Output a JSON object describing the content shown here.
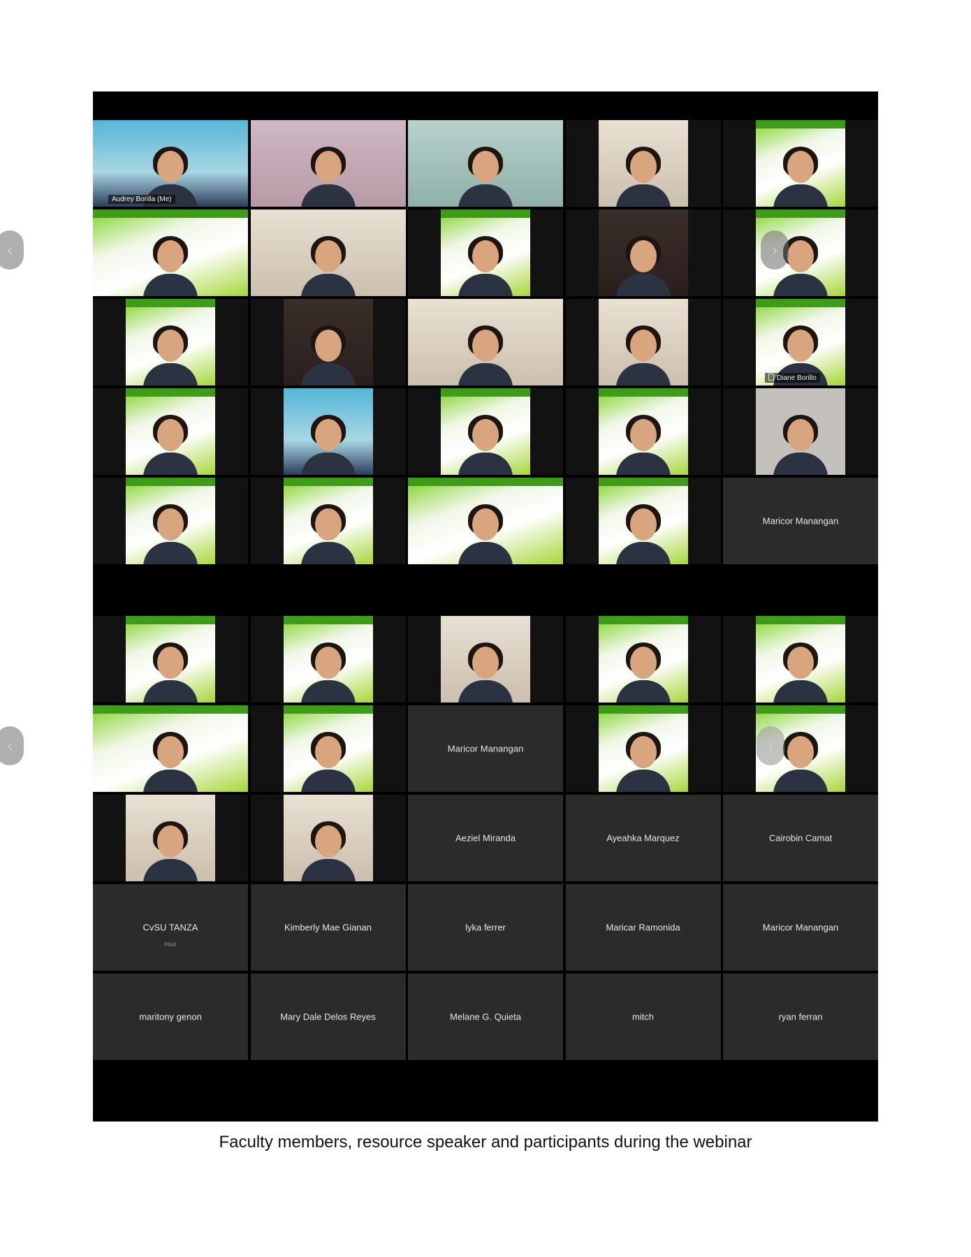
{
  "top_panel": {
    "tiles": [
      {
        "kind": "video",
        "style": "wall-blue full",
        "name": "Audrey Borilla  (Me)"
      },
      {
        "kind": "video",
        "style": "wall-pink full",
        "name": ""
      },
      {
        "kind": "video",
        "style": "wall-teal full",
        "name": ""
      },
      {
        "kind": "video",
        "style": "wall-cream center",
        "name": ""
      },
      {
        "kind": "video",
        "style": "slide center",
        "name": ""
      },
      {
        "kind": "video",
        "style": "slide full",
        "name": ""
      },
      {
        "kind": "video",
        "style": "wall-cream full",
        "name": ""
      },
      {
        "kind": "video",
        "style": "slide center",
        "name": ""
      },
      {
        "kind": "video",
        "style": "wall-dark center",
        "name": ""
      },
      {
        "kind": "video",
        "style": "slide center",
        "name": ""
      },
      {
        "kind": "video",
        "style": "slide center",
        "name": ""
      },
      {
        "kind": "video",
        "style": "wall-dark center",
        "name": ""
      },
      {
        "kind": "video",
        "style": "wall-cream full",
        "name": ""
      },
      {
        "kind": "video",
        "style": "wall-cream center",
        "name": ""
      },
      {
        "kind": "video",
        "style": "slide center",
        "name": "Diane Borillo"
      },
      {
        "kind": "video",
        "style": "slide center",
        "name": ""
      },
      {
        "kind": "video",
        "style": "wall-blue center",
        "name": ""
      },
      {
        "kind": "video",
        "style": "slide center",
        "name": ""
      },
      {
        "kind": "video",
        "style": "slide center",
        "name": ""
      },
      {
        "kind": "video",
        "style": "wall-gray center",
        "name": ""
      },
      {
        "kind": "video",
        "style": "slide center",
        "name": ""
      },
      {
        "kind": "video",
        "style": "slide center",
        "name": ""
      },
      {
        "kind": "video",
        "style": "slide full",
        "name": ""
      },
      {
        "kind": "video",
        "style": "slide center",
        "name": ""
      },
      {
        "kind": "name",
        "name": "Maricor Manangan",
        "sub": ""
      }
    ]
  },
  "bottom_panel": {
    "tiles": [
      {
        "kind": "video",
        "style": "slide center",
        "name": ""
      },
      {
        "kind": "video",
        "style": "slide center",
        "name": ""
      },
      {
        "kind": "video",
        "style": "wall-cream center",
        "name": ""
      },
      {
        "kind": "video",
        "style": "slide center",
        "name": ""
      },
      {
        "kind": "video",
        "style": "slide center",
        "name": ""
      },
      {
        "kind": "video",
        "style": "slide full",
        "name": ""
      },
      {
        "kind": "video",
        "style": "slide center",
        "name": ""
      },
      {
        "kind": "name",
        "name": "Maricor Manangan",
        "sub": ""
      },
      {
        "kind": "video",
        "style": "slide center",
        "name": ""
      },
      {
        "kind": "video",
        "style": "slide center",
        "name": ""
      },
      {
        "kind": "video",
        "style": "wall-cream center",
        "name": ""
      },
      {
        "kind": "video",
        "style": "wall-cream center",
        "name": ""
      },
      {
        "kind": "name",
        "name": "Aeziel Miranda",
        "sub": ""
      },
      {
        "kind": "name",
        "name": "Ayeahka Marquez",
        "sub": ""
      },
      {
        "kind": "name",
        "name": "Cairobin Camat",
        "sub": ""
      },
      {
        "kind": "name",
        "name": "CvSU TANZA",
        "sub": "Host"
      },
      {
        "kind": "name",
        "name": "Kimberly Mae Gianan",
        "sub": ""
      },
      {
        "kind": "name",
        "name": "lyka ferrer",
        "sub": ""
      },
      {
        "kind": "name",
        "name": "Maricar Ramonida",
        "sub": ""
      },
      {
        "kind": "name",
        "name": "Maricor Manangan",
        "sub": ""
      },
      {
        "kind": "name",
        "name": "maritony genon",
        "sub": ""
      },
      {
        "kind": "name",
        "name": "Mary Dale Delos Reyes",
        "sub": ""
      },
      {
        "kind": "name",
        "name": "Melane G. Quieta",
        "sub": ""
      },
      {
        "kind": "name",
        "name": "mitch",
        "sub": ""
      },
      {
        "kind": "name",
        "name": "ryan ferran",
        "sub": ""
      }
    ]
  },
  "nav": {
    "prev_glyph": "‹",
    "next_glyph": "›"
  },
  "caption": "Faculty members, resource speaker and participants during the webinar"
}
